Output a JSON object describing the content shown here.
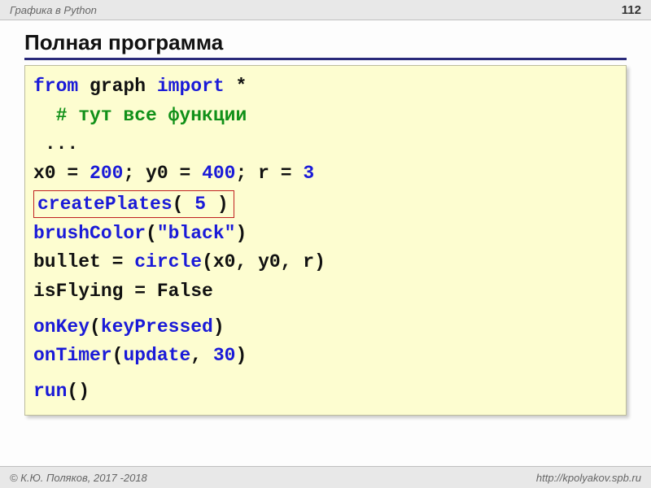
{
  "header": {
    "topic": "Графика в Python",
    "page": "112"
  },
  "title": "Полная программа",
  "code": {
    "kw_from": "from",
    "mod": "graph",
    "kw_import": "import",
    "star": "*",
    "comment": "# тут все функции",
    "dots": "...",
    "l_x0": "x0 = ",
    "v_x0": "200",
    "sep1": "; y0 = ",
    "v_y0": "400",
    "sep2": "; r = ",
    "v_r": "3",
    "cp_name": "createPlates",
    "cp_open": "( ",
    "cp_arg": "5",
    "cp_close": " )",
    "bc_name": "brushColor",
    "bc_open": "(",
    "bc_arg": "\"black\"",
    "bc_close": ")",
    "bullet_left": "bullet = ",
    "circle_name": "circle",
    "circle_args": "(x0, y0, r)",
    "isflying": "isFlying = False",
    "onkey_name": "onKey",
    "onkey_open": "(",
    "onkey_arg": "keyPressed",
    "onkey_close": ")",
    "ontimer_name": "onTimer",
    "ontimer_open": "(",
    "ontimer_arg1": "update",
    "ontimer_sep": ", ",
    "ontimer_arg2": "30",
    "ontimer_close": ")",
    "run_name": "run",
    "run_paren": "()"
  },
  "footer": {
    "left": "© К.Ю. Поляков, 2017 -2018",
    "right": "http://kpolyakov.spb.ru"
  }
}
